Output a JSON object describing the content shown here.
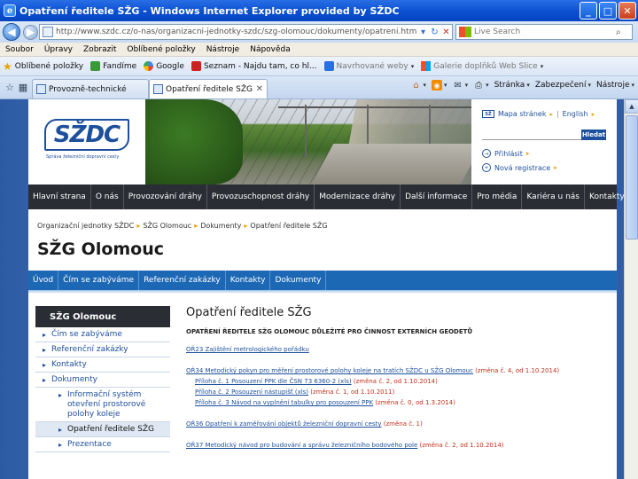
{
  "window": {
    "title": "Opatření ředitele SŽG - Windows Internet Explorer provided by SŽDC",
    "app_icon": "e"
  },
  "addressbar": {
    "url": "http://www.szdc.cz/o-nas/organizacni-jednotky-szdc/szg-olomouc/dokumenty/opatreni.htm",
    "search_placeholder": "Live Search"
  },
  "menu": [
    "Soubor",
    "Úpravy",
    "Zobrazit",
    "Oblíbené položky",
    "Nástroje",
    "Nápověda"
  ],
  "favorites": [
    {
      "label": "Oblíbené položky",
      "icon": "star-icon",
      "style": "star"
    },
    {
      "label": "Fandíme",
      "icon": "green-icon",
      "style": "green"
    },
    {
      "label": "Google",
      "icon": "google-icon",
      "style": "gg"
    },
    {
      "label": "Seznam - Najdu tam, co hl...",
      "icon": "seznam-icon",
      "style": "red"
    },
    {
      "label": "Navrhované weby",
      "icon": "ie-icon",
      "style": "blue"
    },
    {
      "label": "Galerie doplňků Web Slice",
      "icon": "ms-icon",
      "style": "ms"
    }
  ],
  "tabs": [
    {
      "label": "Provozně-technické",
      "active": false
    },
    {
      "label": "Opatření ředitele SŽG",
      "active": true
    }
  ],
  "commandbar": [
    "Stránka",
    "Zabezpečení",
    "Nástroje"
  ],
  "site": {
    "logo": "SŽDC",
    "logo_tagline": "Správa železniční dopravní cesty",
    "top_links": {
      "map": "Mapa stránek",
      "lang": "English"
    },
    "search_button": "Hledat",
    "login": "Přihlásit",
    "register": "Nová registrace"
  },
  "mainnav": [
    "Hlavní strana",
    "O nás",
    "Provozování dráhy",
    "Provozuschopnost dráhy",
    "Modernizace dráhy",
    "Další informace",
    "Pro média",
    "Kariéra u nás",
    "Kontakty"
  ],
  "breadcrumb": [
    "Organizační jednotky SŽDC",
    "SŽG Olomouc",
    "Dokumenty",
    "Opatření ředitele SŽG"
  ],
  "page_title": "SŽG Olomouc",
  "subnav": [
    "Úvod",
    "Čím se zabýváme",
    "Referenční zakázky",
    "Kontakty",
    "Dokumenty"
  ],
  "sidemenu": {
    "heading": "SŽG Olomouc",
    "items": [
      {
        "label": "Čím se zabýváme",
        "sub": false,
        "active": false
      },
      {
        "label": "Referenční zakázky",
        "sub": false,
        "active": false
      },
      {
        "label": "Kontakty",
        "sub": false,
        "active": false
      },
      {
        "label": "Dokumenty",
        "sub": false,
        "active": false
      },
      {
        "label": "Informační systém otevření prostorové polohy koleje",
        "sub": true,
        "active": false
      },
      {
        "label": "Opatření ředitele SŽG",
        "sub": true,
        "active": true
      },
      {
        "label": "Prezentace",
        "sub": true,
        "active": false
      }
    ]
  },
  "content": {
    "heading": "Opatření ředitele SŽG",
    "subheading": "OPATŘENÍ ŘEDITELE SŽG OLOMOUC DŮLEŽITÉ PRO ČINNOST EXTERNÍCH GEODETŮ",
    "docs": [
      {
        "link": "OŘ23 Zajištění metrologického pořádku",
        "change": "",
        "indent": false
      },
      {
        "link": "OŘ34 Metodický pokyn pro měření prostorové polohy koleje na tratích SŽDC u SŽG Olomouc",
        "change": "(změna č. 4, od 1.10.2014)",
        "indent": false
      },
      {
        "link": "Příloha č. 1 Posouzení PPK dle ČSN 73 6360-2 (xls)",
        "change": "(změna č. 2, od 1.10.2014)",
        "indent": true
      },
      {
        "link": "Příloha č. 2 Posouzení nástupišť (xls)",
        "change": "(změna č. 1, od 1.10.2011)",
        "indent": true
      },
      {
        "link": "Příloha č. 3 Návod na vyplnění tabulky pro posouzení PPK",
        "change": "(změna č. 0, od 1.3.2014)",
        "indent": true
      },
      {
        "link": "OŘ36 Opatření k zaměřování objektů železniční dopravní cesty",
        "change": "(změna č. 1)",
        "indent": false
      },
      {
        "link": "OŘ37 Metodický návod pro budování a správu železničního bodového pole",
        "change": "(změna č. 2, od 1.10.2014)",
        "indent": false
      }
    ]
  },
  "colors": {
    "accent": "#1d4f9c",
    "nav_dark": "#2a2d33",
    "subnav_blue": "#1d68b5",
    "change_red": "#c0301c",
    "arrow_orange": "#f0a000"
  }
}
